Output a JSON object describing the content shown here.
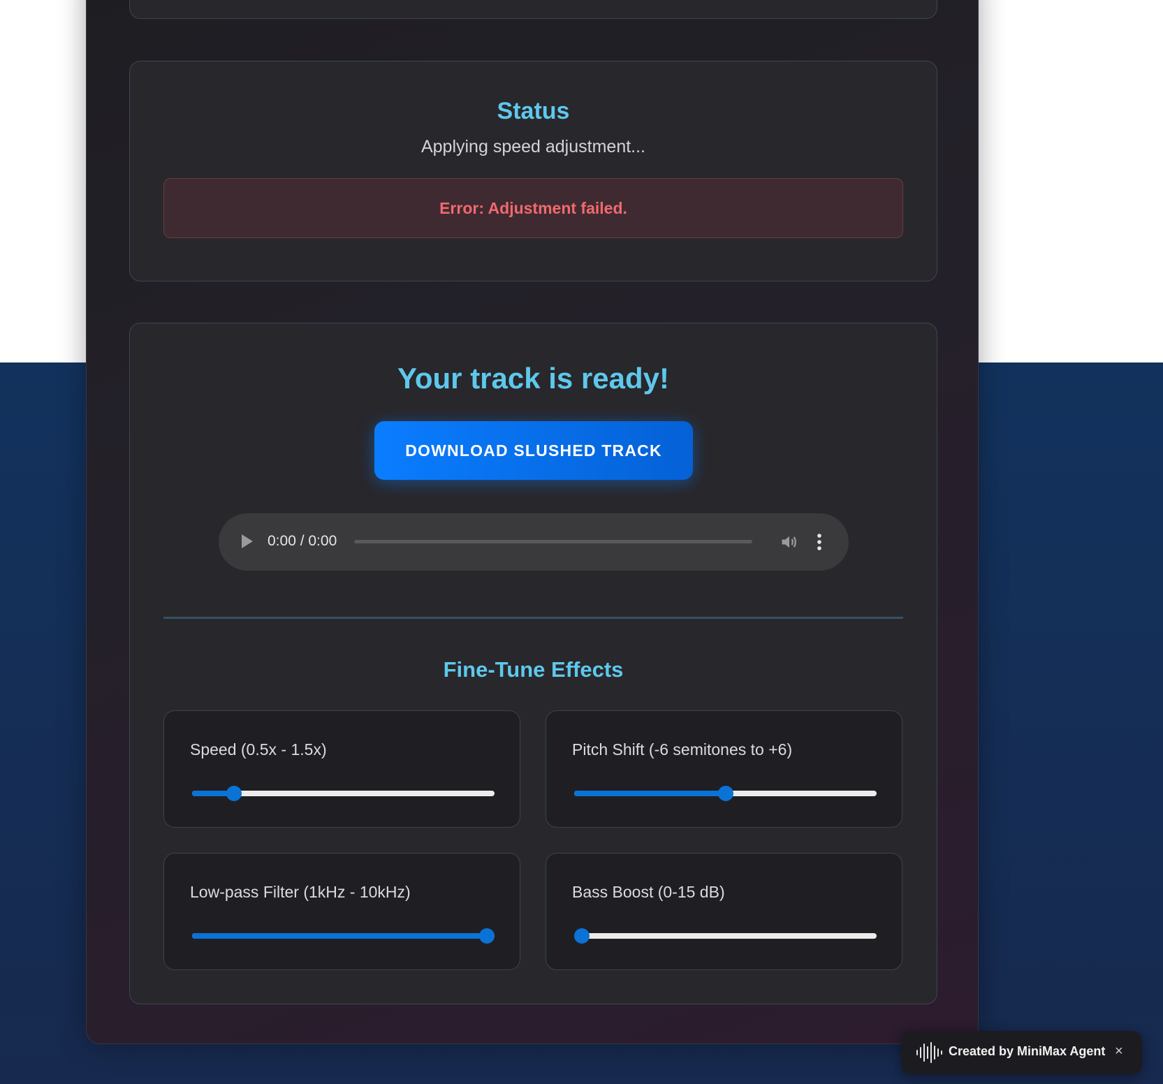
{
  "status": {
    "title": "Status",
    "message": "Applying speed adjustment...",
    "error": "Error: Adjustment failed."
  },
  "result": {
    "title": "Your track is ready!",
    "download_label": "DOWNLOAD SLUSHED TRACK",
    "player": {
      "time": "0:00 / 0:00",
      "progress": 0,
      "play_icon": "play-icon",
      "volume_icon": "volume-icon",
      "menu_icon": "more-vertical-icon"
    }
  },
  "fine_tune": {
    "title": "Fine-Tune Effects",
    "controls": [
      {
        "label": "Speed (0.5x - 1.5x)",
        "value": 0.62,
        "min": 0.5,
        "max": 1.5
      },
      {
        "label": "Pitch Shift (-6 semitones to +6)",
        "value": 0,
        "min": -6,
        "max": 6
      },
      {
        "label": "Low-pass Filter (1kHz - 10kHz)",
        "value": 10,
        "min": 1,
        "max": 10
      },
      {
        "label": "Bass Boost (0-15 dB)",
        "value": 0,
        "min": 0,
        "max": 15
      }
    ]
  },
  "badge": {
    "text": "Created by MiniMax Agent",
    "icon": "waveform-icon",
    "close": "×"
  },
  "colors": {
    "accent": "#5ec8ec",
    "button": "#0a7dff",
    "error": "#f06a6e",
    "slider": "#0b72d6"
  }
}
